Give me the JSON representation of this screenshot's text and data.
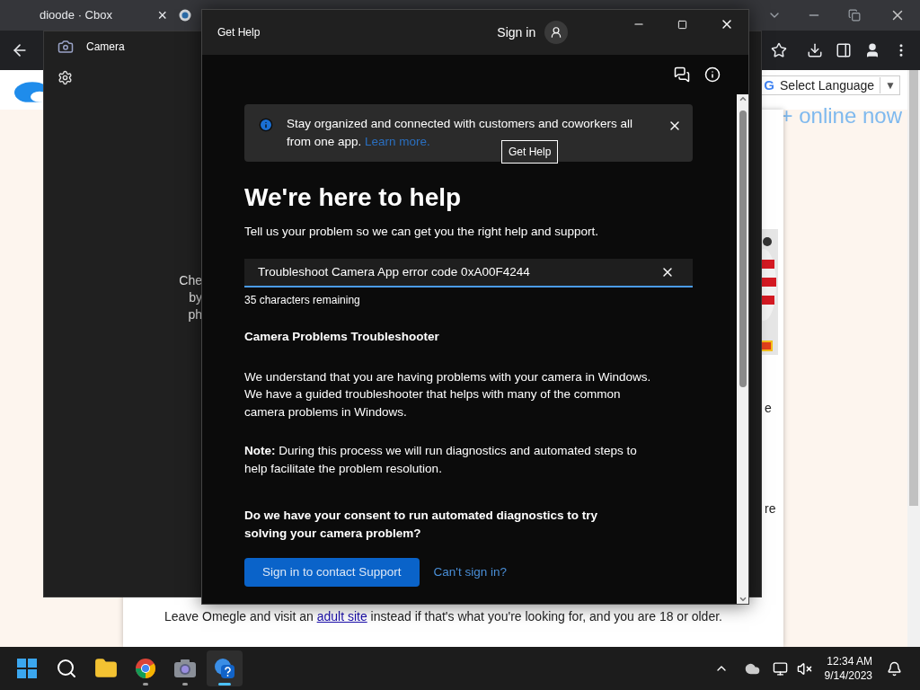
{
  "browser": {
    "tabs": [
      {
        "title": "dioode · Cbox",
        "close": "×"
      }
    ],
    "page": {
      "google_mark": "G",
      "select_language": "Select Language",
      "select_arrow": "▼",
      "online_badge": "+ online now",
      "fragments": [
        "e",
        "re"
      ],
      "notice_before": "Leave Omegle and visit an ",
      "notice_link": "adult site",
      "notice_after": " instead if that's what you're looking for, and you are 18 or older."
    }
  },
  "camera_window": {
    "title": "Camera",
    "fragments": [
      "Che",
      "by",
      "ph"
    ]
  },
  "help_window": {
    "title": "Get Help",
    "sign_in": "Sign in",
    "banner": {
      "text": "Stay organized and connected with customers and coworkers all from one app.",
      "link": "Learn more.",
      "tooltip": "Get Help"
    },
    "heading": "We're here to help",
    "subheading": "Tell us your problem so we can get you the right help and support.",
    "search": {
      "value": "Troubleshoot Camera App error code 0xA00F4244",
      "counter": "35 characters remaining"
    },
    "article": {
      "title": "Camera Problems Troubleshooter",
      "paragraphs": [
        "We understand that you are having problems with your camera in Windows. We have a guided troubleshooter that helps with many of the common camera problems in Windows.",
        "**Note:** During this process we will run diagnostics and automated steps to help facilitate the problem resolution."
      ],
      "question": "Do we have your consent to run automated diagnostics to try solving your camera problem?"
    },
    "actions": {
      "primary": "Sign in to contact Support",
      "link": "Can't sign in?"
    }
  },
  "taskbar": {
    "apps": [
      {
        "kind": "start",
        "selected": false,
        "running": false
      },
      {
        "kind": "search",
        "selected": false,
        "running": false
      },
      {
        "kind": "files",
        "selected": false,
        "running": false
      },
      {
        "kind": "browser",
        "selected": false,
        "running": true
      },
      {
        "kind": "camera",
        "selected": false,
        "running": true
      },
      {
        "kind": "help",
        "selected": true,
        "running": true
      }
    ],
    "clock": {
      "time": "12:34 AM",
      "date": "9/14/2023"
    }
  }
}
